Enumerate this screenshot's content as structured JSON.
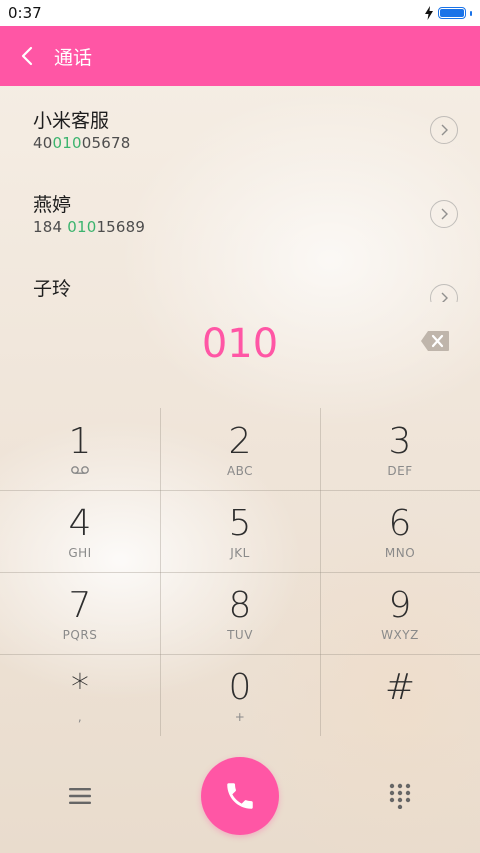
{
  "status_bar": {
    "time": "0:37",
    "charging_icon": "lightning-icon",
    "battery_icon": "battery-icon"
  },
  "app_bar": {
    "title": "通话",
    "back_icon": "chevron-left-icon"
  },
  "contacts": [
    {
      "name": "小米客服",
      "number_before": "40",
      "number_match": "010",
      "number_after": "05678"
    },
    {
      "name": "燕婷",
      "number_before": "184 ",
      "number_match": "010",
      "number_after": "15689"
    },
    {
      "name": "子玲",
      "number_before": "",
      "number_match": "",
      "number_after": ""
    }
  ],
  "dial_display": {
    "value": "010",
    "backspace_icon": "backspace-icon"
  },
  "keypad": [
    {
      "digit": "1",
      "letters": "",
      "sub_icon": "voicemail-icon"
    },
    {
      "digit": "2",
      "letters": "ABC"
    },
    {
      "digit": "3",
      "letters": "DEF"
    },
    {
      "digit": "4",
      "letters": "GHI"
    },
    {
      "digit": "5",
      "letters": "JKL"
    },
    {
      "digit": "6",
      "letters": "MNO"
    },
    {
      "digit": "7",
      "letters": "PQRS"
    },
    {
      "digit": "8",
      "letters": "TUV"
    },
    {
      "digit": "9",
      "letters": "WXYZ"
    },
    {
      "digit": "*",
      "letters": ","
    },
    {
      "digit": "0",
      "letters": "+"
    },
    {
      "digit": "#",
      "letters": ""
    }
  ],
  "bottom_bar": {
    "menu_icon": "menu-icon",
    "call_icon": "phone-icon",
    "dialpad_icon": "dialpad-icon"
  },
  "colors": {
    "accent": "#ff56a5",
    "match": "#3cb46e"
  }
}
